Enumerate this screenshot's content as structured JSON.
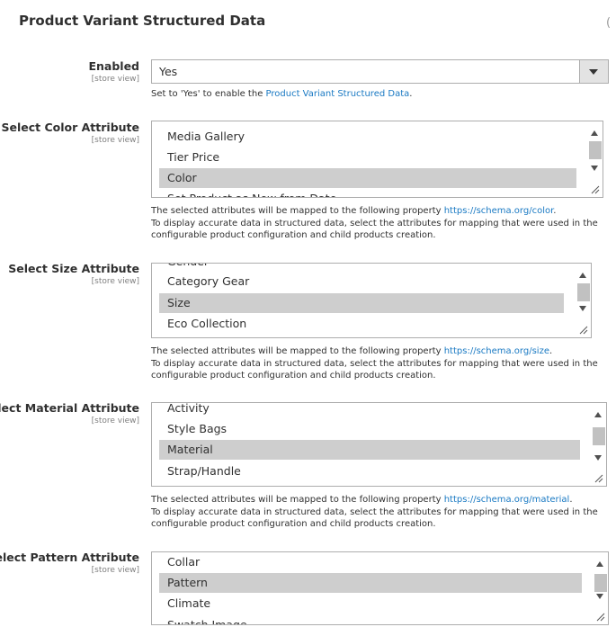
{
  "section": {
    "title": "Product Variant Structured Data"
  },
  "enabled": {
    "label": "Enabled",
    "scope": "[store view]",
    "value": "Yes",
    "note_prefix": "Set to 'Yes' to enable the ",
    "note_link": "Product Variant Structured Data",
    "note_suffix": "."
  },
  "color": {
    "label": "Select Color Attribute",
    "scope": "[store view]",
    "options": [
      "Media Gallery",
      "Tier Price",
      "Color",
      "Set Product as New from Date"
    ],
    "selected": "Color",
    "note_prefix": "The selected attributes will be mapped to the following property ",
    "note_link": "https://schema.org/color",
    "note_suffix": ".",
    "note_line2": "To display accurate data in structured data, select the attributes for mapping that were used in the",
    "note_line3": "configurable product configuration and child products creation."
  },
  "size": {
    "label": "Select Size Attribute",
    "scope": "[store view]",
    "options": [
      "Gender",
      "Category Gear",
      "Size",
      "Eco Collection"
    ],
    "selected": "Size",
    "note_prefix": "The selected attributes will be mapped to the following property ",
    "note_link": "https://schema.org/size",
    "note_suffix": ".",
    "note_line2": "To display accurate data in structured data, select the attributes for mapping that were used in the",
    "note_line3": "configurable product configuration and child products creation."
  },
  "material": {
    "label": "Select Material Attribute",
    "scope": "[store view]",
    "options": [
      "Activity",
      "Style Bags",
      "Material",
      "Strap/Handle"
    ],
    "selected": "Material",
    "note_prefix": "The selected attributes will be mapped to the following property ",
    "note_link": "https://schema.org/material",
    "note_suffix": ".",
    "note_line2": "To display accurate data in structured data, select the attributes for mapping that were used in the",
    "note_line3": "configurable product configuration and child products creation."
  },
  "pattern": {
    "label": "Select Pattern Attribute",
    "scope": "[store view]",
    "options": [
      "Collar",
      "Pattern",
      "Climate",
      "Swatch Image"
    ],
    "selected": "Pattern"
  },
  "colors": {
    "link": "#1979c3",
    "selected_bg": "#cecece",
    "border": "#adadad"
  }
}
